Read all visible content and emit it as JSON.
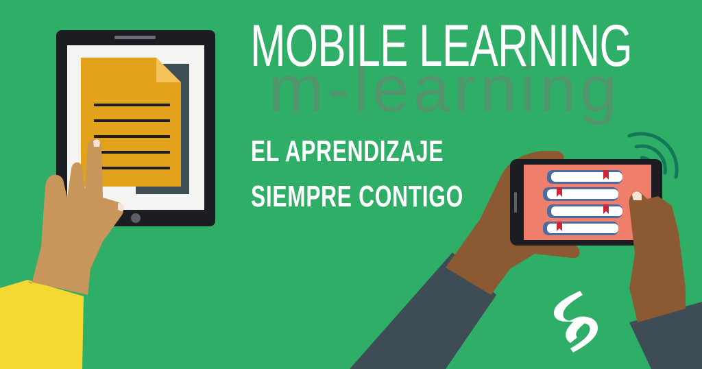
{
  "headline": "MOBILE LEARNING",
  "subtitle": "m-learning",
  "tagline_line1": "EL APRENDIZAJE",
  "tagline_line2": "SIEMPRE CONTIGO",
  "colors": {
    "background": "#2fae68",
    "tablet_frame": "#1c1d22",
    "document": "#e3a21c",
    "phone_screen": "#ef7e6a",
    "sleeve_yellow": "#f6d832",
    "sleeve_dark": "#3e4c55",
    "skin_light": "#c8955a",
    "skin_dark": "#8c5a32"
  },
  "icons": [
    "tablet-illustration",
    "document-icon",
    "phone-illustration",
    "books-icon",
    "wifi-signal-icon",
    "logo-s-icon"
  ]
}
